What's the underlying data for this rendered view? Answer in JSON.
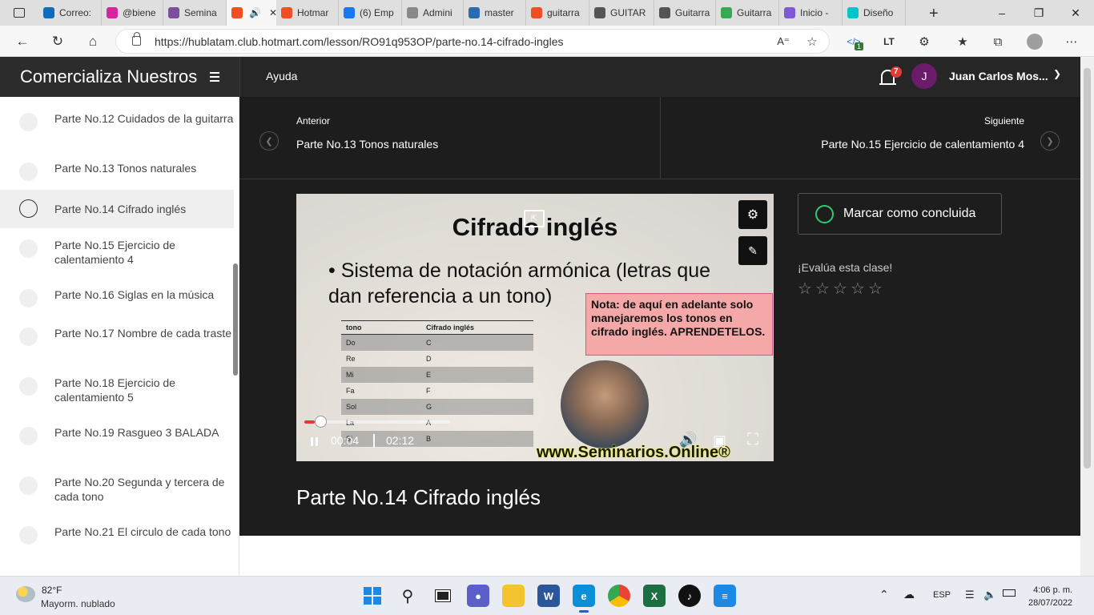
{
  "browser": {
    "tabs": [
      {
        "label": "Correo:",
        "icon": "outlook-icon",
        "color": "#0f6cbd"
      },
      {
        "label": "@biene",
        "icon": "instagram-icon",
        "color": "#d6249f"
      },
      {
        "label": "Semina",
        "icon": "seminar-icon",
        "color": "#7a4f9c"
      },
      {
        "label": "",
        "icon": "hotmart-flame-icon",
        "color": "#f04e23",
        "active": true
      },
      {
        "label": "Hotmar",
        "icon": "hotmart-flame-icon",
        "color": "#f04e23"
      },
      {
        "label": "(6) Emp",
        "icon": "facebook-icon",
        "color": "#1877f2"
      },
      {
        "label": "Admini",
        "icon": "admin-icon",
        "color": "#888888"
      },
      {
        "label": "master",
        "icon": "search-icon",
        "color": "#2b6cb0"
      },
      {
        "label": "guitarra",
        "icon": "hotmart-icon",
        "color": "#f04e23"
      },
      {
        "label": "GUITAR",
        "icon": "document-icon",
        "color": "#555555"
      },
      {
        "label": "Guitarra",
        "icon": "document-icon",
        "color": "#555555"
      },
      {
        "label": "Guitarra",
        "icon": "drive-icon",
        "color": "#34a853"
      },
      {
        "label": "Inicio -",
        "icon": "canva-icon",
        "color": "#7d5bd6"
      },
      {
        "label": "Diseño",
        "icon": "canva-icon",
        "color": "#00c4cc"
      }
    ],
    "url": "https://hublatam.club.hotmart.com/lesson/RO91q953OP/parte-no.14-cifrado-ingles",
    "extension_badge": "1"
  },
  "site": {
    "course_title": "Comercializa Nuestros",
    "help_label": "Ayuda",
    "notification_count": "7",
    "avatar_initial": "J",
    "user_name": "Juan Carlos Mos..."
  },
  "sidebar": {
    "lessons": [
      {
        "label": "Parte No.12 Cuidados de la guitarra"
      },
      {
        "label": "Parte No.13 Tonos naturales"
      },
      {
        "label": "Parte No.14 Cifrado inglés",
        "active": true
      },
      {
        "label": "Parte No.15 Ejercicio de calentamiento 4"
      },
      {
        "label": "Parte No.16 Siglas en la música"
      },
      {
        "label": "Parte No.17 Nombre de cada traste"
      },
      {
        "label": "Parte No.18 Ejercicio de calentamiento 5"
      },
      {
        "label": "Parte No.19 Rasgueo 3 BALADA"
      },
      {
        "label": "Parte No.20 Segunda y tercera de cada tono"
      },
      {
        "label": "Parte No.21 El circulo de cada tono"
      }
    ]
  },
  "nav": {
    "prev_small": "Anterior",
    "prev_title": "Parte No.13 Tonos naturales",
    "next_small": "Siguiente",
    "next_title": "Parte No.15 Ejercicio de calentamiento 4"
  },
  "video": {
    "slide_title": "Cifrado inglés",
    "slide_bullet": "• Sistema de notación armónica (letras que dan referencia a un tono)",
    "slide_note": "Nota: de aquí en adelante solo manejaremos los tonos en cifrado inglés. APRENDETELOS.",
    "table_headers": [
      "tono",
      "Cifrado inglés"
    ],
    "table_rows": [
      [
        "Do",
        "C"
      ],
      [
        "Re",
        "D"
      ],
      [
        "Mi",
        "E"
      ],
      [
        "Fa",
        "F"
      ],
      [
        "Sol",
        "G"
      ],
      [
        "La",
        "A"
      ],
      [
        "Si",
        "B"
      ]
    ],
    "watermark": "www.Seminarios.Online®",
    "current_time": "00:04",
    "duration": "02:12",
    "progress_fraction": 0.03
  },
  "lesson": {
    "title": "Parte No.14 Cifrado inglés",
    "mark_complete": "Marcar como concluida",
    "rate_prompt": "¡Evalúa esta clase!",
    "stars": 5,
    "rating": 0
  },
  "taskbar": {
    "temperature": "82°F",
    "weather": "Mayorm. nublado",
    "language": "ESP",
    "time": "4:06 p. m.",
    "date": "28/07/2022"
  }
}
